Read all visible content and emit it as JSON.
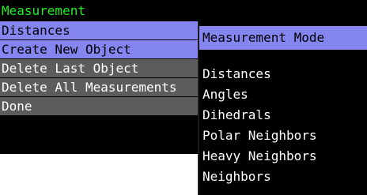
{
  "menu": {
    "title": "Measurement",
    "items": [
      {
        "label": "Distances"
      },
      {
        "label": "Create New Object"
      },
      {
        "label": "Delete Last Object"
      },
      {
        "label": "Delete All Measurements"
      },
      {
        "label": "Done"
      }
    ]
  },
  "submenu": {
    "title": "Measurement Mode",
    "items": [
      {
        "label": "Distances"
      },
      {
        "label": "Angles"
      },
      {
        "label": "Dihedrals"
      },
      {
        "label": "Polar Neighbors"
      },
      {
        "label": "Heavy Neighbors"
      },
      {
        "label": "Neighbors"
      }
    ]
  },
  "colors": {
    "title_text": "#1df01d",
    "highlight": "#8585ef",
    "menu_row": "#5c5c5c",
    "panel_bg": "#000000"
  }
}
